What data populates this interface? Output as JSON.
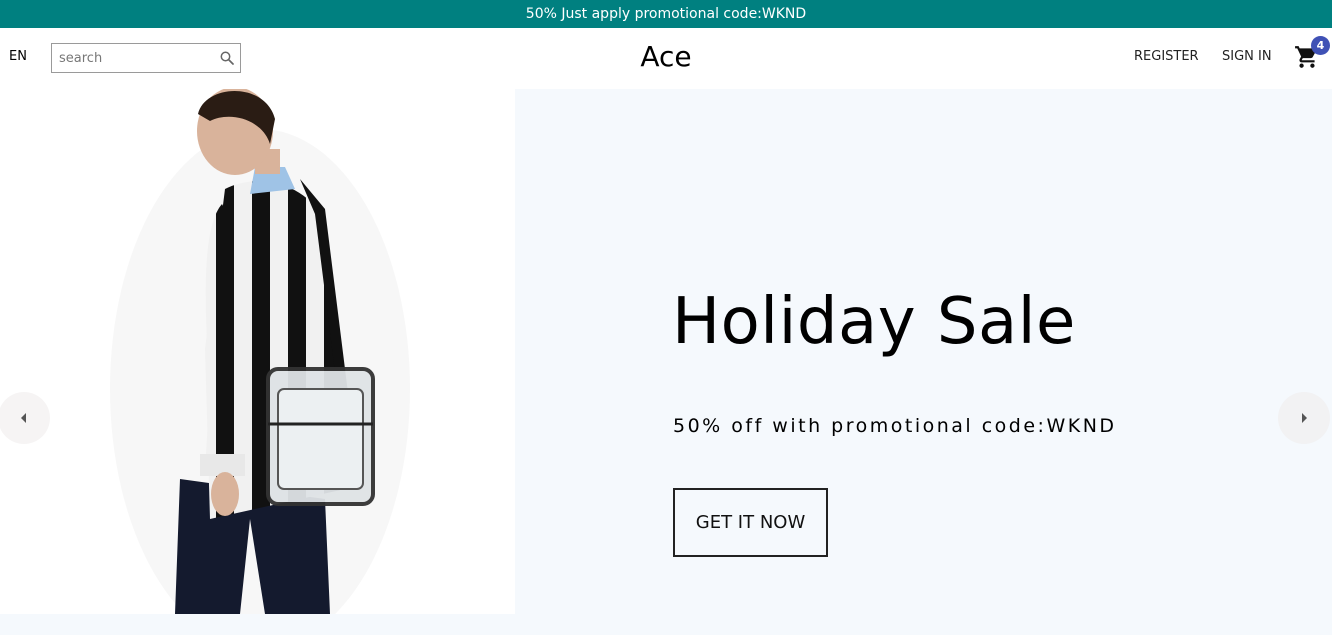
{
  "promo_bar": {
    "text": "50% Just apply promotional code:WKND"
  },
  "header": {
    "language": "EN",
    "search": {
      "placeholder": "search",
      "value": ""
    },
    "logo": "Ace",
    "nav": {
      "register": "REGISTER",
      "sign_in": "SIGN IN"
    },
    "cart": {
      "count": "4"
    }
  },
  "hero": {
    "title": "Holiday Sale",
    "subtitle": "50% off with promotional code:WKND",
    "cta_label": "GET IT NOW",
    "image": "man in black-and-white striped cardigan carrying clear crossbody bag"
  },
  "colors": {
    "promo_bg": "#008080",
    "hero_bg": "#f5f9fd",
    "badge_bg": "#3f51b5"
  },
  "icons": {
    "search": "search-icon",
    "cart": "cart-icon",
    "prev": "chevron-left-icon",
    "next": "chevron-right-icon"
  }
}
